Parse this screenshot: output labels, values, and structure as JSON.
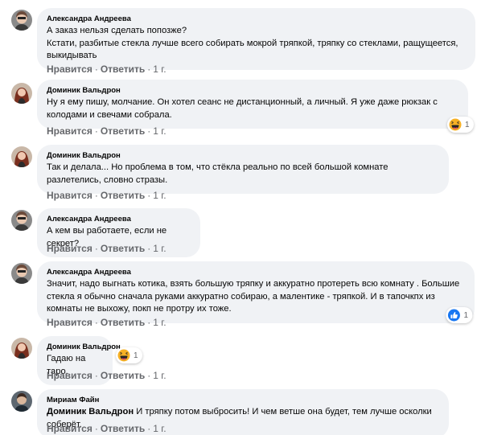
{
  "labels": {
    "like": "Нравится",
    "reply": "Ответить",
    "dot": "·"
  },
  "comments": [
    {
      "author": "Александра Андреева",
      "lines": [
        "А заказ нельзя сделать попозже?",
        "Кстати, разбитые стекла лучше всего собирать мокрой тряпкой, тряпку со стеклами, ращущеется, выкидывать"
      ],
      "time": "1 г."
    },
    {
      "author": "Доминик Вальдрон",
      "lines": [
        "Ну я ему пишу, молчание. Он хотел сеанс не дистанционный, а личный. Я уже даже рюкзак с колодами и свечами собрала."
      ],
      "time": "1 г.",
      "reaction": {
        "icon": "haha-icon",
        "count": "1"
      }
    },
    {
      "author": "Доминик Вальдрон",
      "lines": [
        "Так и делала... Но проблема в том, что стёкла реально по всей большой комнате разлетелись, словно стразы."
      ],
      "time": "1 г."
    },
    {
      "author": "Александра Андреева",
      "lines": [
        "А кем вы работаете, если не секрет?"
      ],
      "time": "1 г."
    },
    {
      "author": "Александра Андреева",
      "lines": [
        "Значит, надо выгнать котика, взять большую тряпку и аккуратно протереть всю комнату . Большие стекла я обычно сначала руками аккуратно собираю, а малентике - тряпкой. И в тапочкпх из комнаты не выхожу, покп не протру их тоже."
      ],
      "time": "1 г.",
      "reaction": {
        "icon": "like-icon",
        "count": "1"
      }
    },
    {
      "author": "Доминик Вальдрон",
      "lines": [
        "Гадаю на таро."
      ],
      "time": "1 г.",
      "reaction": {
        "icon": "haha-icon",
        "count": "1"
      }
    },
    {
      "author": "Мириам Файн",
      "mention": "Доминик Вальдрон",
      "lines": [
        "И тряпку потом выбросить! И чем ветше она будет, тем лучше осколки соберёт."
      ],
      "time": "1 г."
    }
  ],
  "colors": {
    "bubble": "#f0f2f5",
    "meta": "#65676b",
    "like_blue": "#1877f2",
    "haha_yellow": "#f7b125"
  }
}
